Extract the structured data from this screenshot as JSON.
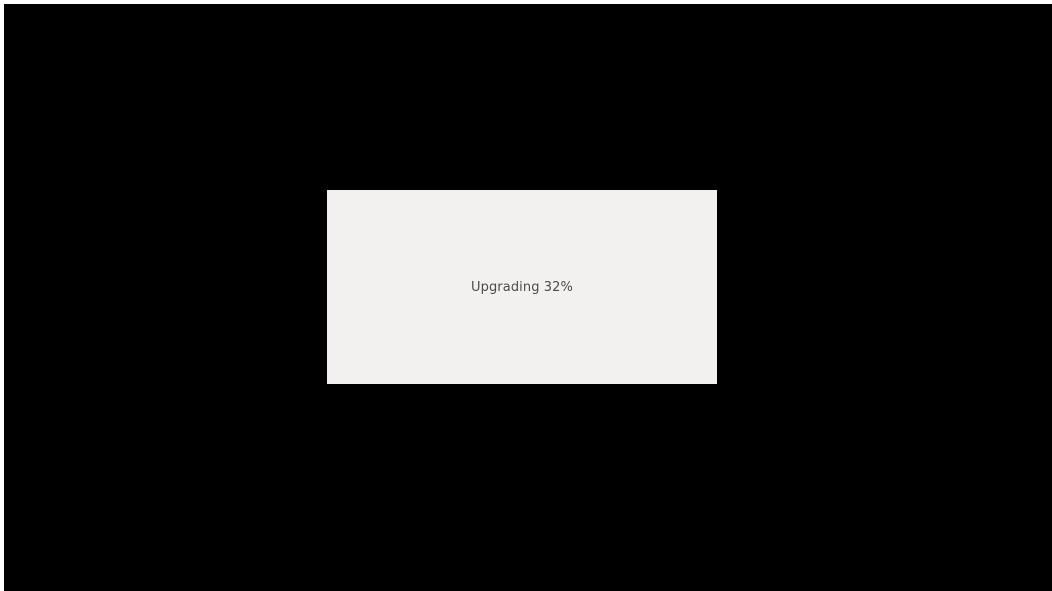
{
  "dialog": {
    "status_text": "Upgrading 32%",
    "progress_percent": 32
  },
  "colors": {
    "background": "#000000",
    "dialog_background": "#f2f1f0",
    "text": "#4c4c4c",
    "outer_edge": "#ffffff"
  }
}
